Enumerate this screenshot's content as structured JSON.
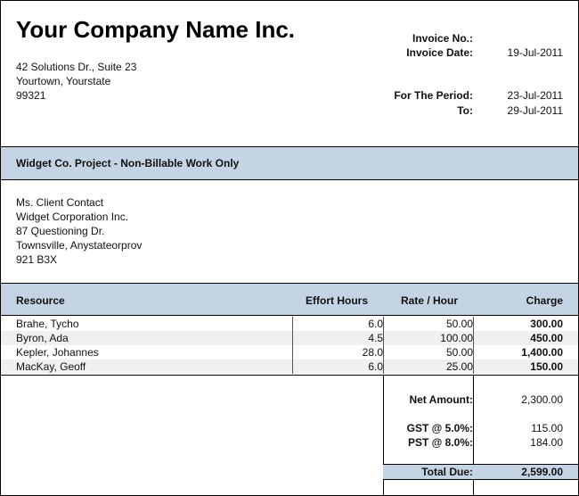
{
  "company": {
    "name": "Your Company Name Inc.",
    "address": [
      "42 Solutions Dr., Suite 23",
      "Yourtown, Yourstate",
      "99321"
    ]
  },
  "invoice": {
    "number_label": "Invoice No.:",
    "number_value": "",
    "date_label": "Invoice Date:",
    "date_value": "19-Jul-2011",
    "period_label": "For The Period:",
    "period_from": "23-Jul-2011",
    "to_label": "To:",
    "period_to": "29-Jul-2011"
  },
  "project": {
    "title": "Widget Co. Project - Non-Billable Work Only"
  },
  "client": {
    "lines": [
      "Ms. Client Contact",
      "Widget Corporation Inc.",
      "87 Questioning Dr.",
      "Townsville, Anystateorprov",
      "921 B3X"
    ]
  },
  "table": {
    "headers": {
      "resource": "Resource",
      "hours": "Effort Hours",
      "rate": "Rate / Hour",
      "charge": "Charge"
    },
    "rows": [
      {
        "resource": "Brahe, Tycho",
        "hours": "6.0",
        "rate": "50.00",
        "charge": "300.00"
      },
      {
        "resource": "Byron, Ada",
        "hours": "4.5",
        "rate": "100.00",
        "charge": "450.00"
      },
      {
        "resource": "Kepler, Johannes",
        "hours": "28.0",
        "rate": "50.00",
        "charge": "1,400.00"
      },
      {
        "resource": "MacKay, Geoff",
        "hours": "6.0",
        "rate": "25.00",
        "charge": "150.00"
      }
    ]
  },
  "totals": {
    "net_label": "Net Amount:",
    "net_value": "2,300.00",
    "gst_label": "GST @ 5.0%:",
    "gst_value": "115.00",
    "pst_label": "PST @ 8.0%:",
    "pst_value": "184.00",
    "due_label": "Total Due:",
    "due_value": "2,599.00"
  },
  "colors": {
    "band": "#c5d4e5",
    "stripe": "#f0f0f0"
  }
}
